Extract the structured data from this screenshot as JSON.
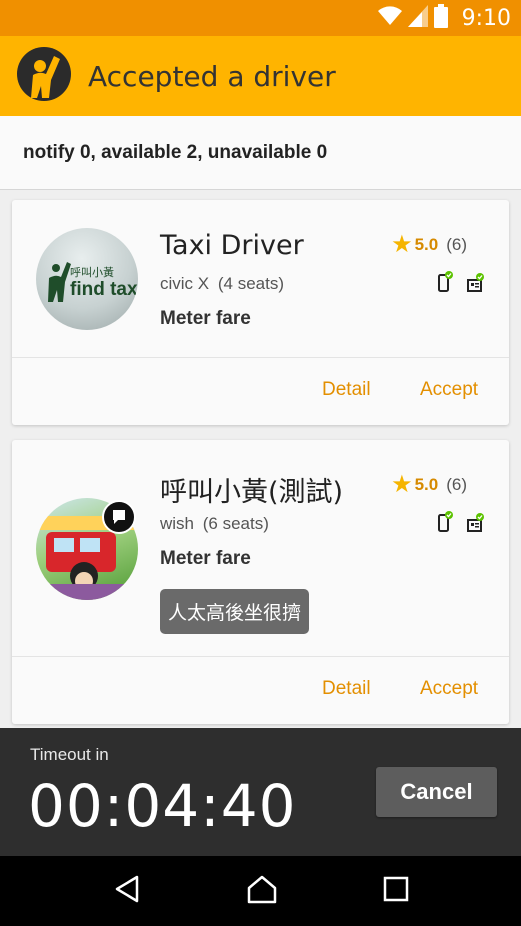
{
  "status_bar": {
    "time": "9:10",
    "icons": [
      "wifi-icon",
      "signal-icon",
      "battery-icon"
    ]
  },
  "app_bar": {
    "title": "Accepted a driver",
    "logo_icon": "waving-person-icon"
  },
  "summary": {
    "text": "notify 0, available 2, unavailable 0"
  },
  "drivers": [
    {
      "name": "Taxi Driver",
      "avatar_text_top": "呼叫小黃",
      "avatar_text_bottom": "find tax",
      "car_model": "civic X",
      "seats": "(4 seats)",
      "fare": "Meter fare",
      "rating": "5.0",
      "rating_count": "(6)",
      "badges": [
        "phone-verified-icon",
        "license-verified-icon"
      ],
      "detail_label": "Detail",
      "accept_label": "Accept"
    },
    {
      "name": "呼叫小黃(測試)",
      "car_model": "wish",
      "seats": "(6 seats)",
      "fare": "Meter fare",
      "note": "人太高後坐很擠",
      "rating": "5.0",
      "rating_count": "(6)",
      "badges": [
        "phone-verified-icon",
        "license-verified-icon"
      ],
      "detail_label": "Detail",
      "accept_label": "Accept"
    }
  ],
  "timeout": {
    "label": "Timeout in",
    "value": "00:04:40",
    "cancel_label": "Cancel"
  },
  "nav_bar": {
    "buttons": [
      "back-icon",
      "home-icon",
      "recents-icon"
    ]
  },
  "colors": {
    "status_bar": "#f09000",
    "app_bar": "#ffb400",
    "accent": "#e38f00",
    "star": "#f5b400",
    "verified": "#5cc200"
  }
}
